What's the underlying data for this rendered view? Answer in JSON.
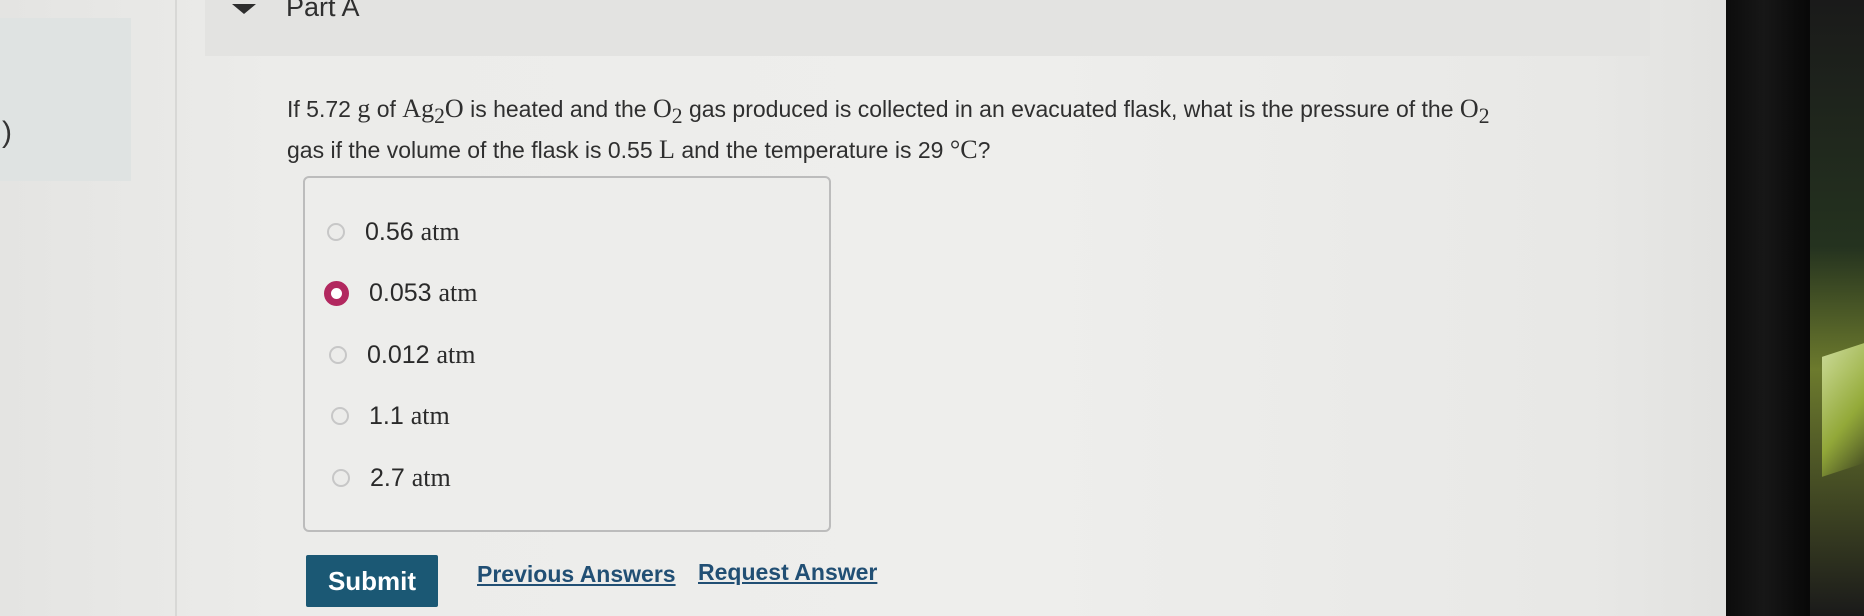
{
  "left_panel": {
    "glyph": ")"
  },
  "part": {
    "title": "Part A"
  },
  "question": {
    "text_1": "If 5.72 ",
    "unit_g": "g",
    "text_2": " of ",
    "compound": "Ag",
    "compound_sub": "2",
    "compound_end": "O",
    "text_3": " is heated and the ",
    "o2": "O",
    "o2_sub": "2",
    "text_4": " gas produced is collected in an evacuated flask, what is the pressure of the ",
    "o2b": "O",
    "o2b_sub": "2",
    "text_5": "gas if the volume of the flask is 0.55 ",
    "unit_l": "L",
    "text_6": " and the temperature is 29 ",
    "unit_c": "°C",
    "text_7": "?"
  },
  "options": [
    {
      "value": "0.56",
      "unit": "atm",
      "selected": false
    },
    {
      "value": "0.053",
      "unit": "atm",
      "selected": true
    },
    {
      "value": "0.012",
      "unit": "atm",
      "selected": false
    },
    {
      "value": "1.1",
      "unit": "atm",
      "selected": false
    },
    {
      "value": "2.7",
      "unit": "atm",
      "selected": false
    }
  ],
  "actions": {
    "submit": "Submit",
    "previous_answers": "Previous Answers",
    "request_answer": "Request Answer"
  },
  "colors": {
    "selected_radio": "#b2285f",
    "submit_bg": "#1b5874",
    "link": "#214f74"
  }
}
